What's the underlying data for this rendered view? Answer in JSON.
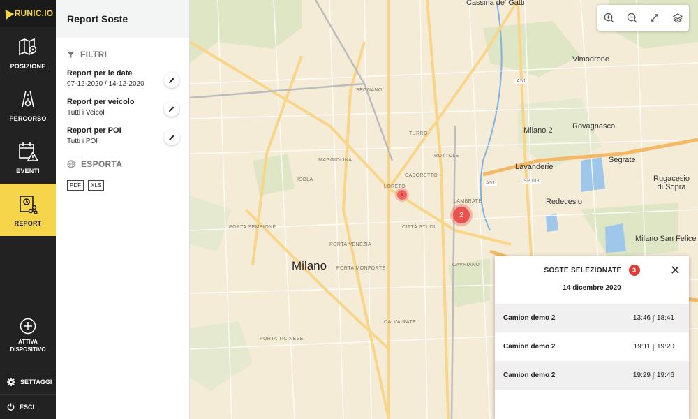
{
  "brand": {
    "logo_text": "RUNIC.IO",
    "accent": "#f7d54a"
  },
  "nav": {
    "items": [
      {
        "label": "POSIZIONE",
        "icon": "map-pin-icon",
        "active": false
      },
      {
        "label": "PERCORSO",
        "icon": "route-icon",
        "active": false
      },
      {
        "label": "EVENTI",
        "icon": "calendar-alert-icon",
        "active": false
      },
      {
        "label": "REPORT",
        "icon": "report-icon",
        "active": true
      }
    ],
    "attiva": {
      "line1": "ATTIVA",
      "line2": "DISPOSITIVO"
    },
    "settings_label": "SETTAGGI",
    "logout_label": "ESCI"
  },
  "panel": {
    "title": "Report Soste",
    "filters_heading": "FILTRI",
    "filters": [
      {
        "title": "Report per le date",
        "value": "07-12-2020 / 14-12-2020"
      },
      {
        "title": "Report per veicolo",
        "value": "Tutti i Veicoli"
      },
      {
        "title": "Report per POI",
        "value": "Tutti i POI"
      }
    ],
    "export_heading": "ESPORTA",
    "exports": [
      "PDF",
      "XLS"
    ]
  },
  "map": {
    "city": "Milano",
    "towns": [
      "Cassina de' Gatti",
      "Vimodrone",
      "Milano 2",
      "Rovagnasco",
      "Segrate",
      "Lavanderie",
      "Rugacesio di Sopra",
      "Redecesio",
      "Milano San Felice"
    ],
    "districts": [
      "SEGNANO",
      "TURRO",
      "ROTTOLE",
      "MAGGIOLINA",
      "CASORETTO",
      "ISOLA",
      "LORETO",
      "CITTÀ STUDI",
      "LAMBRATE",
      "CAVRIANO",
      "PORTA SEMPIONE",
      "PORTA VENEZIA",
      "PORTA MONFORTE",
      "CALVAIRATE",
      "PORTA TICINESE"
    ],
    "road_labels": [
      "A51",
      "A51",
      "SP103"
    ],
    "cluster_count": "2"
  },
  "popup": {
    "title": "SOSTE SELEZIONATE",
    "count": "3",
    "date": "14 dicembre 2020",
    "rows": [
      {
        "name": "Camion demo 2",
        "start": "13:46",
        "end": "18:41"
      },
      {
        "name": "Camion demo 2",
        "start": "19:11",
        "end": "19:20"
      },
      {
        "name": "Camion demo 2",
        "start": "19:29",
        "end": "19:46"
      }
    ]
  }
}
